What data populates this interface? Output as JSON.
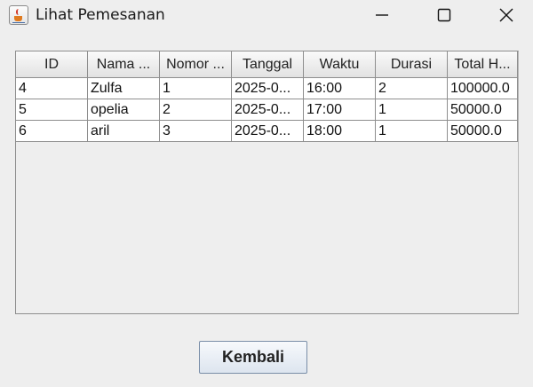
{
  "window": {
    "title": "Lihat Pemesanan",
    "app_icon": "java-cup-icon",
    "controls": [
      "minimize-icon",
      "maximize-icon",
      "close-icon"
    ]
  },
  "table": {
    "columns": [
      "ID",
      "Nama ...",
      "Nomor ...",
      "Tanggal",
      "Waktu",
      "Durasi",
      "Total H..."
    ],
    "rows": [
      [
        "4",
        "Zulfa",
        "1",
        "2025-0...",
        "16:00",
        "2",
        "100000.0"
      ],
      [
        "5",
        "opelia",
        "2",
        "2025-0...",
        "17:00",
        "1",
        "50000.0"
      ],
      [
        "6",
        "aril",
        "3",
        "2025-0...",
        "18:00",
        "1",
        "50000.0"
      ]
    ]
  },
  "actions": {
    "back_label": "Kembali"
  }
}
